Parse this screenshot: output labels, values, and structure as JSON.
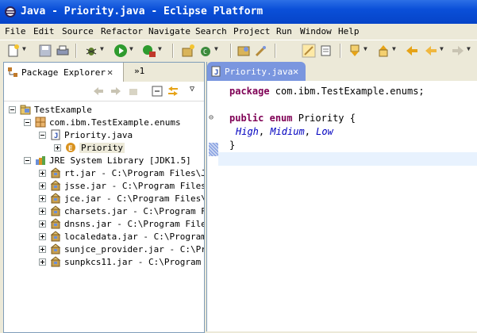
{
  "window": {
    "title": "Java - Priority.java - Eclipse Platform"
  },
  "menu": [
    "File",
    "Edit",
    "Source",
    "Refactor",
    "Navigate",
    "Search",
    "Project",
    "Run",
    "Window",
    "Help"
  ],
  "package_explorer": {
    "tab_label": "Package Explorer",
    "more_label": "»1",
    "tree": [
      {
        "label": "TestExample",
        "indent": 0,
        "icon": "project-icon",
        "expander": "minus"
      },
      {
        "label": "com.ibm.TestExample.enums",
        "indent": 1,
        "icon": "package-icon",
        "expander": "minus"
      },
      {
        "label": "Priority.java",
        "indent": 2,
        "icon": "java-file-icon",
        "expander": "minus"
      },
      {
        "label": "Priority",
        "indent": 3,
        "icon": "enum-icon",
        "expander": "plus",
        "selected": true
      },
      {
        "label": "JRE System Library [JDK1.5]",
        "indent": 1,
        "icon": "library-icon",
        "expander": "minus"
      },
      {
        "label": "rt.jar - C:\\Program Files\\Ja",
        "indent": 2,
        "icon": "jar-icon",
        "expander": "plus"
      },
      {
        "label": "jsse.jar - C:\\Program Files\\",
        "indent": 2,
        "icon": "jar-icon",
        "expander": "plus"
      },
      {
        "label": "jce.jar - C:\\Program Files\\J",
        "indent": 2,
        "icon": "jar-icon",
        "expander": "plus"
      },
      {
        "label": "charsets.jar - C:\\Program Fi",
        "indent": 2,
        "icon": "jar-icon",
        "expander": "plus"
      },
      {
        "label": "dnsns.jar - C:\\Program Files",
        "indent": 2,
        "icon": "jar-icon",
        "expander": "plus"
      },
      {
        "label": "localedata.jar - C:\\Program",
        "indent": 2,
        "icon": "jar-icon",
        "expander": "plus"
      },
      {
        "label": "sunjce_provider.jar - C:\\Pro",
        "indent": 2,
        "icon": "jar-icon",
        "expander": "plus"
      },
      {
        "label": "sunpkcs11.jar - C:\\Program F",
        "indent": 2,
        "icon": "jar-icon",
        "expander": "plus"
      }
    ]
  },
  "editor": {
    "tab_label": "Priority.java",
    "code": {
      "line1_kw": "package",
      "line1_rest": " com.ibm.TestExample.enums;",
      "line2_kw1": "public",
      "line2_kw2": "enum",
      "line2_rest": " Priority {",
      "line3_f1": "High",
      "line3_sep1": ", ",
      "line3_f2": "Midium",
      "line3_sep2": ", ",
      "line3_f3": "Low",
      "line4": "}"
    }
  },
  "colors": {
    "keyword": "#7f0055",
    "field": "#0000c0",
    "titlebar": "#0a4fd8",
    "editor_tab": "#7a96df"
  }
}
